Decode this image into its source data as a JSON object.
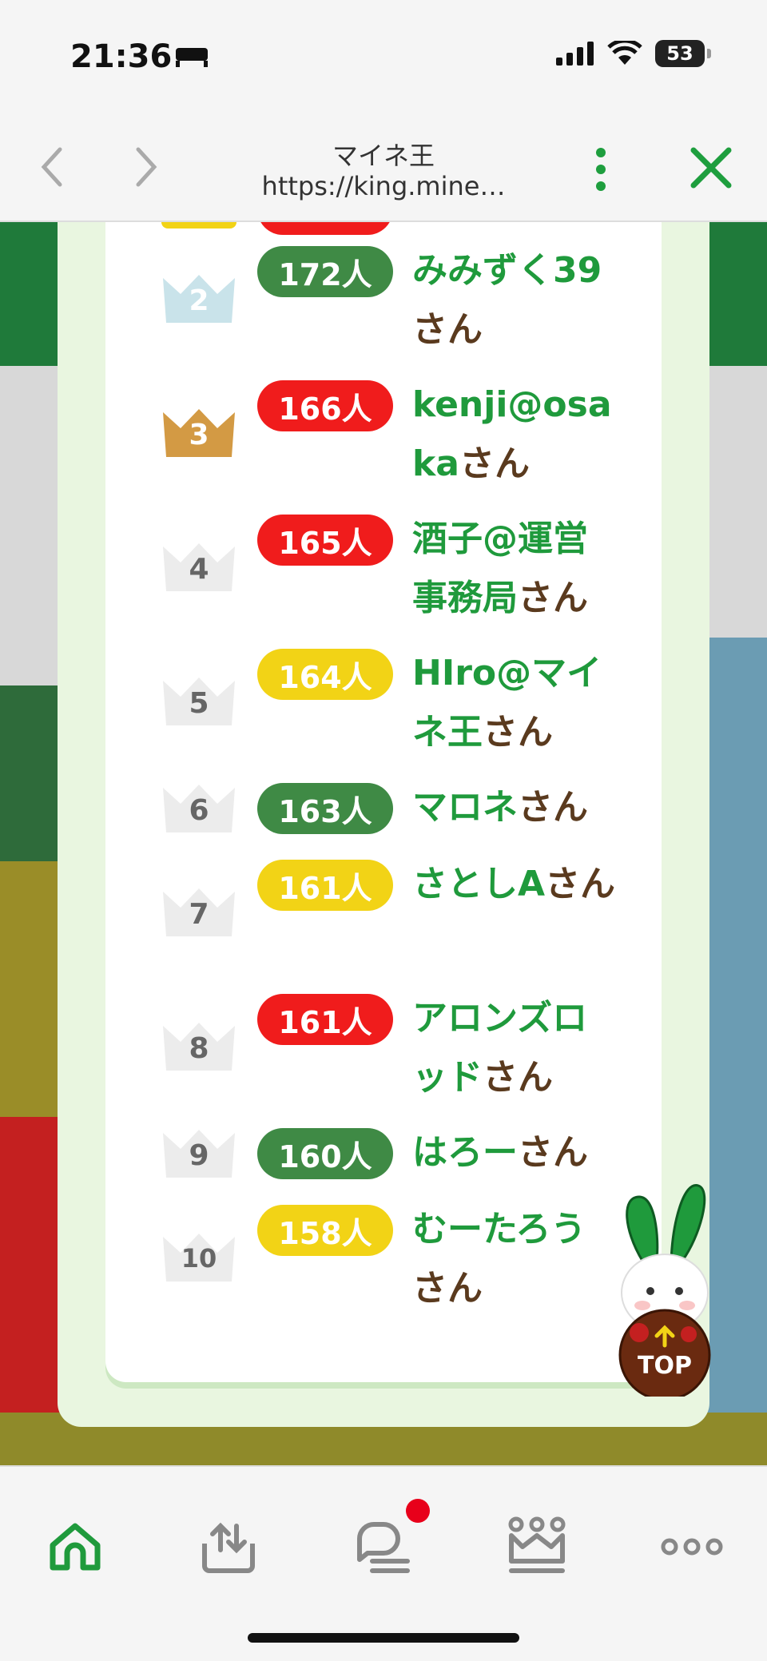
{
  "status_bar": {
    "time": "21:36",
    "battery": "53"
  },
  "browser": {
    "title": "マイネ王",
    "url": "https://king.mine…"
  },
  "ranking": [
    {
      "rank": "2",
      "count": "172人",
      "name": "みみずく39",
      "suffix": "さん",
      "badge_color": "#3f8a45",
      "crown": "silver"
    },
    {
      "rank": "3",
      "count": "166人",
      "name": "kenji@osaka",
      "suffix": "さん",
      "badge_color": "#f01c1c",
      "crown": "bronze"
    },
    {
      "rank": "4",
      "count": "165人",
      "name": "酒子@運営事務局",
      "suffix": "さん",
      "badge_color": "#f01c1c",
      "crown": "plain"
    },
    {
      "rank": "5",
      "count": "164人",
      "name": "HIro@マイネ王",
      "suffix": "さん",
      "badge_color": "#f2d316",
      "crown": "plain"
    },
    {
      "rank": "6",
      "count": "163人",
      "name": "マロネ",
      "suffix": "さん",
      "badge_color": "#3f8a45",
      "crown": "plain"
    },
    {
      "rank": "7",
      "count": "161人",
      "name": "さとしA",
      "suffix": "さん",
      "badge_color": "#f2d316",
      "crown": "plain"
    },
    {
      "rank": "8",
      "count": "161人",
      "name": "アロンズロッド",
      "suffix": "さん",
      "badge_color": "#f01c1c",
      "crown": "plain"
    },
    {
      "rank": "9",
      "count": "160人",
      "name": "はろー",
      "suffix": "さん",
      "badge_color": "#3f8a45",
      "crown": "plain"
    },
    {
      "rank": "10",
      "count": "158人",
      "name": "むーたろう",
      "suffix": "さん",
      "badge_color": "#f2d316",
      "crown": "plain"
    }
  ],
  "top_button": {
    "label": "TOP"
  },
  "tabbar": {
    "items": [
      "home-icon",
      "upload-icon",
      "chat-icon",
      "crown-icon",
      "more-icon"
    ]
  },
  "colors": {
    "accent_green": "#1f9a3c",
    "suffix_brown": "#5a3a1e",
    "notification": "#e8001a"
  }
}
